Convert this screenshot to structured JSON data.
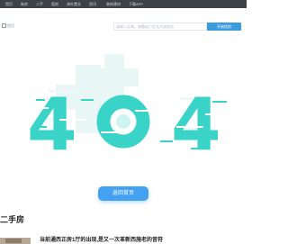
{
  "topnav": {
    "items": [
      "首页",
      "新房",
      "二手",
      "租房",
      "海外置业",
      "资讯",
      "装修建材",
      "下载APP"
    ]
  },
  "search": {
    "logo_label": "首页",
    "placeholder": "请输入区域、商圈或小区名开始找房",
    "button_label": "开始找房"
  },
  "error": {
    "code_left": "4",
    "code_right": "4",
    "home_button_label": "返回首页"
  },
  "section": {
    "title": "二手房",
    "articles": [
      {
        "title": "当前通西正房1厅的出现,是又一次革新西施老的音符"
      }
    ]
  },
  "colors": {
    "topbar": "#3d4249",
    "accent_blue": "#3c9bdc",
    "teal": "#3ad3c8",
    "cross": "#e8f6f5"
  }
}
